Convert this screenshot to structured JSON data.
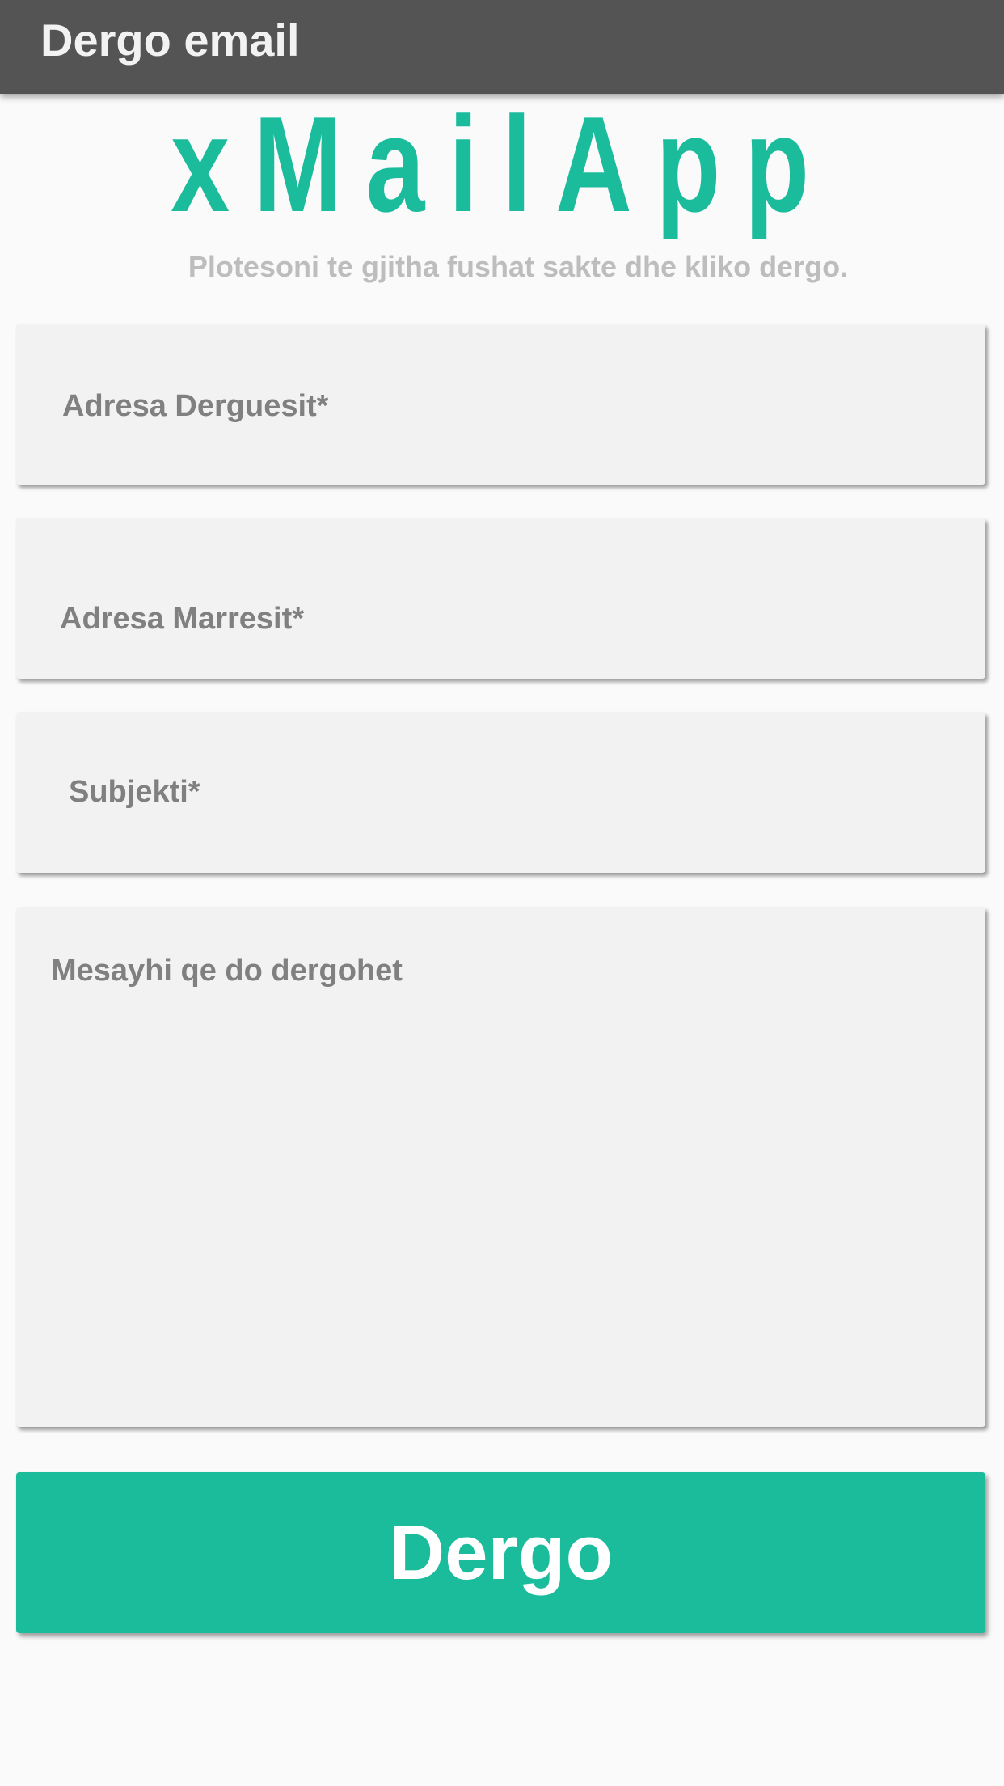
{
  "app_bar": {
    "title": "Dergo email"
  },
  "logo": {
    "text": "xMailApp"
  },
  "instruction": "Plotesoni te gjitha fushat sakte dhe kliko dergo.",
  "form": {
    "sender": {
      "value": "",
      "placeholder": "Adresa Derguesit*"
    },
    "receiver": {
      "value": "",
      "placeholder": "Adresa Marresit*"
    },
    "subject": {
      "value": "",
      "placeholder": "Subjekti*"
    },
    "message": {
      "value": "",
      "placeholder": "Mesayhi qe do dergohet"
    }
  },
  "send_button": {
    "label": "Dergo"
  },
  "colors": {
    "accent": "#1abc9c",
    "app_bar": "#545454",
    "field_background": "#f2f2f2",
    "background": "#fafafa"
  }
}
